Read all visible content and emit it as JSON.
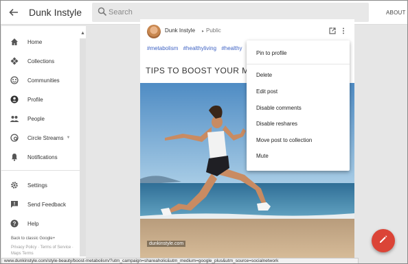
{
  "header": {
    "title": "Dunk Instyle",
    "search_placeholder": "Search",
    "about_label": "ABOUT"
  },
  "sidebar": {
    "items": [
      {
        "label": "Home",
        "icon": "home-icon"
      },
      {
        "label": "Collections",
        "icon": "collections-icon"
      },
      {
        "label": "Communities",
        "icon": "communities-icon"
      },
      {
        "label": "Profile",
        "icon": "profile-icon"
      },
      {
        "label": "People",
        "icon": "people-icon"
      },
      {
        "label": "Circle Streams",
        "icon": "circles-icon"
      },
      {
        "label": "Notifications",
        "icon": "bell-icon"
      }
    ],
    "secondary": [
      {
        "label": "Settings",
        "icon": "gear-icon"
      },
      {
        "label": "Send Feedback",
        "icon": "feedback-icon"
      },
      {
        "label": "Help",
        "icon": "help-icon"
      }
    ],
    "classic_link": "Back to classic Google+",
    "footer_links": "Privacy Policy · Terms of Service · Maps Terms"
  },
  "post": {
    "author": "Dunk Instyle",
    "visibility": "Public",
    "hashtags": [
      "#metabolism",
      "#healthyliving",
      "#healthy"
    ],
    "title": "TIPS TO BOOST YOUR META",
    "watermark": "dunkinstyle.com"
  },
  "menu": {
    "items": [
      "Pin to profile",
      "Delete",
      "Edit post",
      "Disable comments",
      "Disable reshares",
      "Move post to collection",
      "Mute"
    ]
  },
  "status_url": "www.dunkinstyle.com/style-beauty/boost-metabolism/?utm_campaign=shareaholic&utm_medium=google_plus&utm_source=socialnetwork",
  "colors": {
    "accent": "#db4437",
    "hashtag": "#3f63c4"
  }
}
